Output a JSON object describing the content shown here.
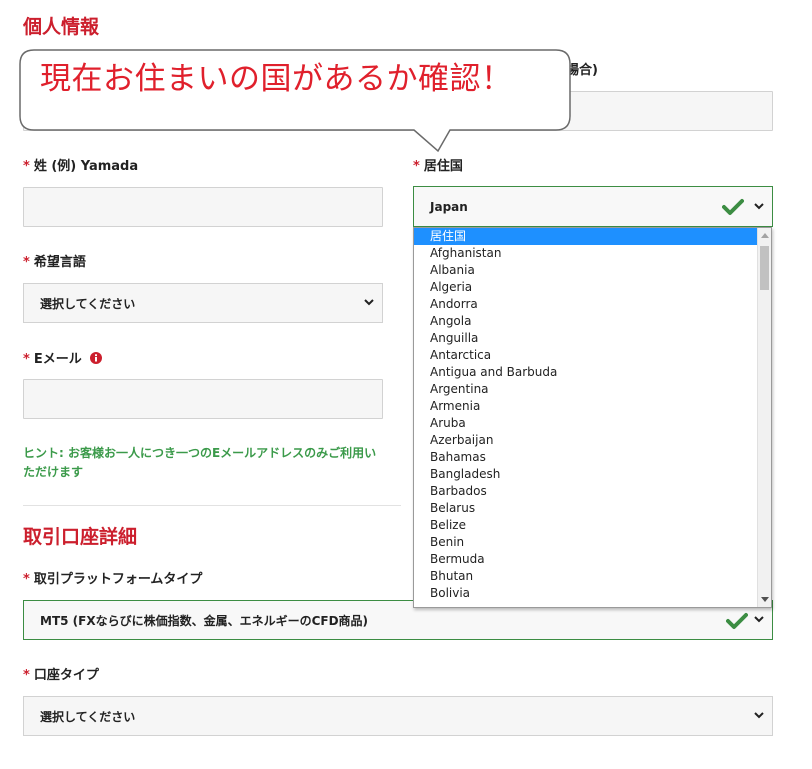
{
  "personal": {
    "title": "個人情報",
    "hidden_label_suffix": "場合)",
    "surname_label": "姓 (例) Yamada",
    "residence_label": "居住国",
    "residence_value": "Japan",
    "language_label": "希望言語",
    "language_value": "選択してください",
    "email_label": "Eメール",
    "hint": "ヒント: お客様お一人につき一つのEメールアドレスのみご利用いただけます",
    "required_mark": "*"
  },
  "callout": {
    "text": "現在お住まいの国があるか確認！"
  },
  "account": {
    "title": "取引口座詳細",
    "platform_label": "取引プラットフォームタイプ",
    "platform_value": "MT5 (FXならびに株価指数、金属、エネルギーのCFD商品)",
    "account_type_label": "口座タイプ",
    "account_type_value": "選択してください"
  },
  "country_dropdown": {
    "selected": "居住国",
    "options": [
      "居住国",
      "Afghanistan",
      "Albania",
      "Algeria",
      "Andorra",
      "Angola",
      "Anguilla",
      "Antarctica",
      "Antigua and Barbuda",
      "Argentina",
      "Armenia",
      "Aruba",
      "Azerbaijan",
      "Bahamas",
      "Bangladesh",
      "Barbados",
      "Belarus",
      "Belize",
      "Benin",
      "Bermuda",
      "Bhutan",
      "Bolivia"
    ]
  },
  "colors": {
    "accent_red": "#cc1f2d",
    "valid_green": "#3c8d43",
    "hint_green": "#3b9a4a",
    "option_highlight": "#1e90ff"
  }
}
